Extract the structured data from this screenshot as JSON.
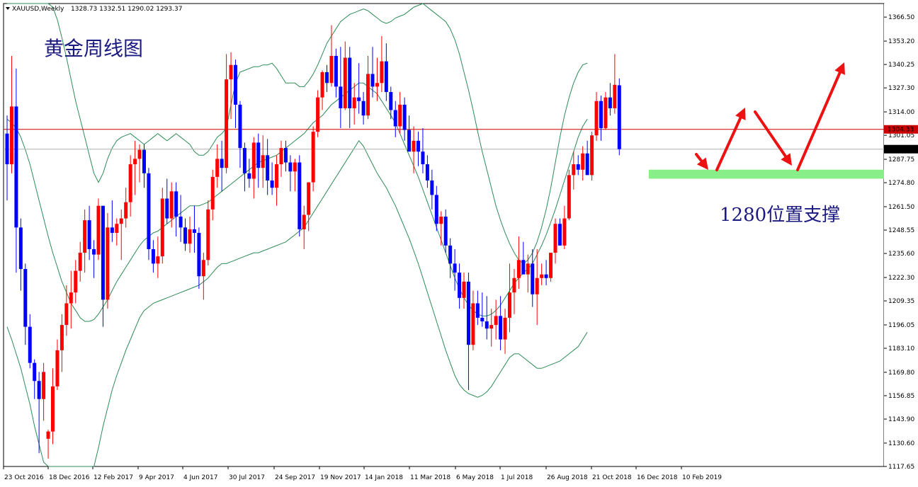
{
  "header": {
    "symbol": "XAUUSD,Weekly",
    "ohlc": "1328.73 1332.51 1290.02 1293.37"
  },
  "colors": {
    "bull": "#ff0000",
    "bear": "#0000ff",
    "band": "#2e8b57",
    "hline": "#cc0000",
    "grayline": "#b0b0b0",
    "support_zone": "#88ee88",
    "arrows": "#ee1111",
    "annotation_text": "#1a1a80"
  },
  "annotations": {
    "title": "黄金周线图",
    "support_label": "1280位置支撑"
  },
  "price_labels": {
    "red_line": "1304.33",
    "current": "1293.37"
  },
  "chart_data": {
    "type": "candlestick",
    "title": "XAUUSD,Weekly",
    "ylim": [
      1117.65,
      1374.0
    ],
    "y_ticks": [
      "1366.50",
      "1353.20",
      "1340.25",
      "1327.30",
      "1314.00",
      "1301.05",
      "1287.75",
      "1274.80",
      "1261.50",
      "1248.55",
      "1235.60",
      "1222.30",
      "1209.35",
      "1196.05",
      "1183.10",
      "1169.80",
      "1156.85",
      "1143.90",
      "1130.60",
      "1117.65"
    ],
    "x_ticks": [
      "23 Oct 2016",
      "18 Dec 2016",
      "12 Feb 2017",
      "9 Apr 2017",
      "4 Jun 2017",
      "30 Jul 2017",
      "24 Sep 2017",
      "19 Nov 2017",
      "14 Jan 2018",
      "11 Mar 2018",
      "6 May 2018",
      "1 Jul 2018",
      "26 Aug 2018",
      "21 Oct 2018",
      "16 Dec 2018",
      "10 Feb 2019"
    ],
    "horizontal_lines": [
      {
        "value": 1304.33,
        "role": "red-line"
      },
      {
        "value": 1293.37,
        "role": "current-price"
      }
    ],
    "support_zone": [
      1277.0,
      1282.0
    ],
    "candles": [
      [
        1302,
        1312,
        1265,
        1285
      ],
      [
        1285,
        1345,
        1280,
        1317
      ],
      [
        1317,
        1338,
        1225,
        1250
      ],
      [
        1250,
        1255,
        1215,
        1227
      ],
      [
        1227,
        1230,
        1185,
        1195
      ],
      [
        1195,
        1202,
        1172,
        1175
      ],
      [
        1175,
        1177,
        1155,
        1165
      ],
      [
        1165,
        1170,
        1125,
        1155
      ],
      [
        1155,
        1175,
        1143,
        1170
      ],
      [
        1133,
        1138,
        1122,
        1137
      ],
      [
        1137,
        1172,
        1130,
        1162
      ],
      [
        1162,
        1188,
        1160,
        1182
      ],
      [
        1182,
        1202,
        1170,
        1196
      ],
      [
        1196,
        1218,
        1190,
        1208
      ],
      [
        1208,
        1226,
        1194,
        1214
      ],
      [
        1214,
        1232,
        1208,
        1226
      ],
      [
        1226,
        1242,
        1220,
        1236
      ],
      [
        1236,
        1260,
        1225,
        1254
      ],
      [
        1254,
        1262,
        1232,
        1238
      ],
      [
        1238,
        1243,
        1222,
        1235
      ],
      [
        1235,
        1266,
        1232,
        1262
      ],
      [
        1262,
        1262,
        1195,
        1210
      ],
      [
        1210,
        1258,
        1205,
        1250
      ],
      [
        1250,
        1265,
        1242,
        1247
      ],
      [
        1247,
        1255,
        1240,
        1252
      ],
      [
        1252,
        1260,
        1232,
        1255
      ],
      [
        1255,
        1272,
        1250,
        1264
      ],
      [
        1264,
        1290,
        1256,
        1285
      ],
      [
        1285,
        1298,
        1268,
        1288
      ],
      [
        1288,
        1296,
        1275,
        1293
      ],
      [
        1293,
        1296,
        1272,
        1280
      ],
      [
        1280,
        1283,
        1232,
        1238
      ],
      [
        1238,
        1243,
        1225,
        1230
      ],
      [
        1230,
        1245,
        1222,
        1234
      ],
      [
        1234,
        1272,
        1230,
        1266
      ],
      [
        1266,
        1277,
        1252,
        1255
      ],
      [
        1255,
        1275,
        1250,
        1270
      ],
      [
        1270,
        1275,
        1245,
        1256
      ],
      [
        1256,
        1268,
        1242,
        1250
      ],
      [
        1250,
        1255,
        1237,
        1241
      ],
      [
        1241,
        1256,
        1236,
        1249
      ],
      [
        1249,
        1262,
        1236,
        1247
      ],
      [
        1247,
        1250,
        1216,
        1223
      ],
      [
        1223,
        1236,
        1210,
        1232
      ],
      [
        1232,
        1265,
        1229,
        1260
      ],
      [
        1260,
        1282,
        1254,
        1278
      ],
      [
        1278,
        1296,
        1272,
        1288
      ],
      [
        1288,
        1298,
        1270,
        1283
      ],
      [
        1283,
        1346,
        1280,
        1332
      ],
      [
        1332,
        1347,
        1310,
        1340
      ],
      [
        1340,
        1343,
        1305,
        1318
      ],
      [
        1318,
        1320,
        1283,
        1294
      ],
      [
        1294,
        1297,
        1270,
        1280
      ],
      [
        1280,
        1288,
        1272,
        1277
      ],
      [
        1277,
        1300,
        1266,
        1297
      ],
      [
        1297,
        1302,
        1272,
        1283
      ],
      [
        1283,
        1301,
        1272,
        1290
      ],
      [
        1290,
        1299,
        1268,
        1276
      ],
      [
        1276,
        1286,
        1268,
        1272
      ],
      [
        1272,
        1290,
        1262,
        1285
      ],
      [
        1285,
        1298,
        1278,
        1294
      ],
      [
        1294,
        1298,
        1281,
        1286
      ],
      [
        1286,
        1290,
        1270,
        1281
      ],
      [
        1281,
        1288,
        1270,
        1286
      ],
      [
        1286,
        1290,
        1245,
        1249
      ],
      [
        1249,
        1262,
        1238,
        1257
      ],
      [
        1257,
        1270,
        1248,
        1275
      ],
      [
        1275,
        1306,
        1270,
        1303
      ],
      [
        1303,
        1326,
        1300,
        1322
      ],
      [
        1322,
        1337,
        1315,
        1336
      ],
      [
        1336,
        1340,
        1325,
        1330
      ],
      [
        1330,
        1362,
        1328,
        1345
      ],
      [
        1345,
        1349,
        1322,
        1328
      ],
      [
        1328,
        1350,
        1305,
        1316
      ],
      [
        1316,
        1353,
        1315,
        1344
      ],
      [
        1344,
        1350,
        1305,
        1316
      ],
      [
        1316,
        1330,
        1307,
        1322
      ],
      [
        1322,
        1341,
        1313,
        1320
      ],
      [
        1320,
        1325,
        1307,
        1312
      ],
      [
        1312,
        1345,
        1310,
        1335
      ],
      [
        1335,
        1350,
        1322,
        1328
      ],
      [
        1328,
        1344,
        1320,
        1330
      ],
      [
        1330,
        1356,
        1325,
        1342
      ],
      [
        1342,
        1352,
        1320,
        1325
      ],
      [
        1325,
        1328,
        1310,
        1315
      ],
      [
        1315,
        1320,
        1300,
        1306
      ],
      [
        1306,
        1325,
        1302,
        1318
      ],
      [
        1318,
        1322,
        1298,
        1304
      ],
      [
        1304,
        1312,
        1295,
        1292
      ],
      [
        1292,
        1306,
        1280,
        1298
      ],
      [
        1298,
        1303,
        1284,
        1292
      ],
      [
        1292,
        1305,
        1280,
        1285
      ],
      [
        1285,
        1290,
        1272,
        1276
      ],
      [
        1276,
        1282,
        1260,
        1268
      ],
      [
        1268,
        1273,
        1248,
        1252
      ],
      [
        1252,
        1259,
        1240,
        1256
      ],
      [
        1256,
        1260,
        1236,
        1240
      ],
      [
        1240,
        1244,
        1222,
        1230
      ],
      [
        1230,
        1238,
        1215,
        1225
      ],
      [
        1225,
        1230,
        1205,
        1211
      ],
      [
        1211,
        1225,
        1205,
        1220
      ],
      [
        1220,
        1225,
        1160,
        1185
      ],
      [
        1185,
        1215,
        1182,
        1208
      ],
      [
        1208,
        1215,
        1196,
        1200
      ],
      [
        1200,
        1214,
        1195,
        1198
      ],
      [
        1198,
        1212,
        1188,
        1194
      ],
      [
        1194,
        1205,
        1184,
        1196
      ],
      [
        1196,
        1210,
        1188,
        1201
      ],
      [
        1201,
        1212,
        1182,
        1188
      ],
      [
        1188,
        1205,
        1180,
        1200
      ],
      [
        1200,
        1230,
        1192,
        1214
      ],
      [
        1214,
        1227,
        1202,
        1222
      ],
      [
        1222,
        1245,
        1216,
        1232
      ],
      [
        1232,
        1242,
        1225,
        1224
      ],
      [
        1224,
        1235,
        1214,
        1230
      ],
      [
        1230,
        1238,
        1206,
        1213
      ],
      [
        1213,
        1238,
        1196,
        1222
      ],
      [
        1222,
        1230,
        1218,
        1224
      ],
      [
        1224,
        1232,
        1218,
        1222
      ],
      [
        1222,
        1235,
        1220,
        1236
      ],
      [
        1236,
        1255,
        1230,
        1252
      ],
      [
        1252,
        1255,
        1240,
        1240
      ],
      [
        1240,
        1262,
        1238,
        1255
      ],
      [
        1255,
        1282,
        1254,
        1279
      ],
      [
        1279,
        1292,
        1271,
        1285
      ],
      [
        1285,
        1290,
        1279,
        1282
      ],
      [
        1282,
        1295,
        1276,
        1291
      ],
      [
        1291,
        1298,
        1284,
        1279
      ],
      [
        1279,
        1303,
        1276,
        1301
      ],
      [
        1301,
        1325,
        1298,
        1320
      ],
      [
        1320,
        1323,
        1298,
        1305
      ],
      [
        1305,
        1325,
        1304,
        1322
      ],
      [
        1322,
        1330,
        1312,
        1316
      ],
      [
        1316,
        1346,
        1313,
        1329
      ],
      [
        1328.73,
        1332.51,
        1290.02,
        1293.37
      ]
    ],
    "bollinger": {
      "upper": [
        1425,
        1422,
        1418,
        1415,
        1410,
        1404,
        1398,
        1390,
        1384,
        1378,
        1372,
        1365,
        1355,
        1344,
        1332,
        1320,
        1310,
        1300,
        1290,
        1280,
        1275,
        1280,
        1288,
        1294,
        1298,
        1300,
        1301,
        1302,
        1300,
        1298,
        1296,
        1298,
        1300,
        1302,
        1300,
        1298,
        1300,
        1302,
        1300,
        1298,
        1296,
        1292,
        1290,
        1290,
        1292,
        1296,
        1300,
        1302,
        1305,
        1318,
        1330,
        1336,
        1337,
        1338,
        1339,
        1339,
        1340,
        1340,
        1341,
        1338,
        1334,
        1330,
        1330,
        1330,
        1328,
        1328,
        1331,
        1335,
        1340,
        1346,
        1352,
        1356,
        1360,
        1364,
        1366,
        1368,
        1369,
        1370,
        1371,
        1370,
        1368,
        1366,
        1364,
        1363,
        1364,
        1366,
        1367,
        1368,
        1370,
        1372,
        1373,
        1374,
        1372,
        1370,
        1368,
        1366,
        1364,
        1360,
        1354,
        1346,
        1336,
        1326,
        1315,
        1303,
        1292,
        1282,
        1272,
        1262,
        1254,
        1247,
        1241,
        1236,
        1232,
        1230,
        1232,
        1236,
        1242,
        1250,
        1260,
        1272,
        1286,
        1300,
        1312,
        1322,
        1330,
        1336,
        1340,
        1341
      ],
      "middle": [
        1310,
        1308,
        1305,
        1300,
        1293,
        1285,
        1275,
        1265,
        1255,
        1245,
        1236,
        1228,
        1220,
        1214,
        1208,
        1204,
        1200,
        1198,
        1198,
        1199,
        1202,
        1206,
        1210,
        1215,
        1220,
        1224,
        1228,
        1232,
        1236,
        1240,
        1243,
        1245,
        1247,
        1248,
        1250,
        1252,
        1254,
        1256,
        1258,
        1260,
        1262,
        1262,
        1262,
        1263,
        1264,
        1266,
        1268,
        1270,
        1272,
        1274,
        1276,
        1278,
        1280,
        1282,
        1284,
        1286,
        1287,
        1288,
        1289,
        1290,
        1292,
        1294,
        1296,
        1298,
        1300,
        1302,
        1305,
        1308,
        1310,
        1312,
        1315,
        1318,
        1320,
        1322,
        1324,
        1326,
        1328,
        1330,
        1330,
        1328,
        1326,
        1324,
        1320,
        1316,
        1312,
        1308,
        1302,
        1296,
        1290,
        1284,
        1278,
        1271,
        1264,
        1257,
        1250,
        1243,
        1236,
        1229,
        1222,
        1216,
        1211,
        1207,
        1204,
        1202,
        1201,
        1201,
        1202,
        1204,
        1207,
        1211,
        1215,
        1219,
        1222,
        1225,
        1227,
        1230,
        1235,
        1240,
        1246,
        1253,
        1260,
        1268,
        1276,
        1284,
        1292,
        1300,
        1306,
        1310
      ],
      "lower": [
        1195,
        1188,
        1180,
        1172,
        1162,
        1152,
        1140,
        1130,
        1120,
        1110,
        1100,
        1092,
        1085,
        1080,
        1078,
        1080,
        1085,
        1092,
        1102,
        1114,
        1128,
        1140,
        1150,
        1160,
        1168,
        1175,
        1182,
        1188,
        1194,
        1200,
        1204,
        1206,
        1208,
        1209,
        1210,
        1211,
        1212,
        1213,
        1214,
        1215,
        1216,
        1217,
        1218,
        1220,
        1222,
        1225,
        1228,
        1230,
        1230,
        1231,
        1232,
        1233,
        1234,
        1235,
        1236,
        1236,
        1237,
        1238,
        1239,
        1240,
        1241,
        1242,
        1244,
        1246,
        1248,
        1250,
        1254,
        1258,
        1262,
        1266,
        1270,
        1274,
        1278,
        1282,
        1286,
        1290,
        1294,
        1298,
        1295,
        1290,
        1285,
        1280,
        1276,
        1272,
        1267,
        1262,
        1256,
        1250,
        1244,
        1237,
        1230,
        1222,
        1214,
        1206,
        1198,
        1190,
        1182,
        1175,
        1168,
        1163,
        1160,
        1158,
        1157,
        1156,
        1157,
        1159,
        1162,
        1166,
        1170,
        1174,
        1178,
        1180,
        1180,
        1178,
        1176,
        1174,
        1172,
        1172,
        1173,
        1174,
        1175,
        1176,
        1178,
        1180,
        1182,
        1184,
        1188,
        1192
      ]
    }
  }
}
